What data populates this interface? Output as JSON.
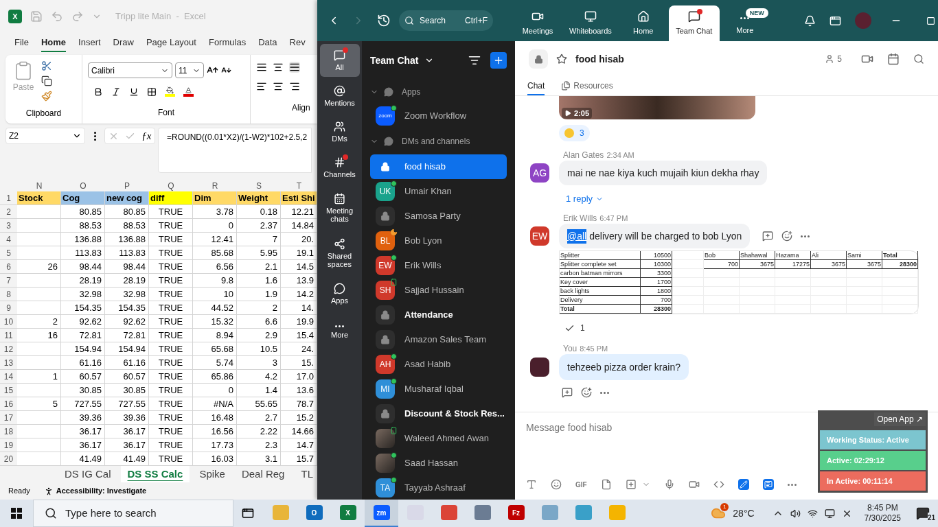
{
  "excel": {
    "logo": "X",
    "title": "Tripp lite Main  -  Excel",
    "menu_tabs": [
      {
        "label": "File",
        "selected": false
      },
      {
        "label": "Home",
        "selected": true
      },
      {
        "label": "Insert",
        "selected": false
      },
      {
        "label": "Draw",
        "selected": false
      },
      {
        "label": "Page Layout",
        "selected": false
      },
      {
        "label": "Formulas",
        "selected": false
      },
      {
        "label": "Data",
        "selected": false
      },
      {
        "label": "Rev",
        "selected": false
      }
    ],
    "ribbon": {
      "paste": "Paste",
      "font_name": "Calibri",
      "font_size": "11",
      "groups": [
        "Clipboard",
        "Font",
        "Align"
      ]
    },
    "name_box": "Z2",
    "function_label": "ƒx",
    "formula": "=ROUND((0.01*X2)/(1-W2)*102+2.5,2",
    "header_row_number": "1",
    "columns": [
      {
        "letter": "N",
        "header": "Stock",
        "color": "#ffd966"
      },
      {
        "letter": "O",
        "header": "Cog",
        "color": "#9bc2e6"
      },
      {
        "letter": "P",
        "header": "new cog",
        "color": "#9bc2e6"
      },
      {
        "letter": "Q",
        "header": "diff",
        "color": "#ffff00"
      },
      {
        "letter": "R",
        "header": "Dim",
        "color": "#ffd966"
      },
      {
        "letter": "S",
        "header": "Weight",
        "color": "#ffd966"
      },
      {
        "letter": "T",
        "header": "Esti Shi",
        "color": "#ffd966"
      }
    ],
    "rows": [
      {
        "number": "2",
        "cells": [
          "",
          "80.85",
          "80.85",
          "TRUE",
          "3.78",
          "0.18",
          "12.21"
        ]
      },
      {
        "number": "3",
        "cells": [
          "",
          "88.53",
          "88.53",
          "TRUE",
          "0",
          "2.37",
          "14.84"
        ]
      },
      {
        "number": "4",
        "cells": [
          "",
          "136.88",
          "136.88",
          "TRUE",
          "12.41",
          "7",
          "20."
        ]
      },
      {
        "number": "5",
        "cells": [
          "",
          "113.83",
          "113.83",
          "TRUE",
          "85.68",
          "5.95",
          "19.1"
        ]
      },
      {
        "number": "6",
        "cells": [
          "26",
          "98.44",
          "98.44",
          "TRUE",
          "6.56",
          "2.1",
          "14.5"
        ]
      },
      {
        "number": "7",
        "cells": [
          "",
          "28.19",
          "28.19",
          "TRUE",
          "9.8",
          "1.6",
          "13.9"
        ]
      },
      {
        "number": "8",
        "cells": [
          "",
          "32.98",
          "32.98",
          "TRUE",
          "10",
          "1.9",
          "14.2"
        ]
      },
      {
        "number": "9",
        "cells": [
          "",
          "154.35",
          "154.35",
          "TRUE",
          "44.52",
          "2",
          "14."
        ]
      },
      {
        "number": "10",
        "cells": [
          "2",
          "92.62",
          "92.62",
          "TRUE",
          "15.32",
          "6.6",
          "19.9"
        ]
      },
      {
        "number": "11",
        "cells": [
          "16",
          "72.81",
          "72.81",
          "TRUE",
          "8.94",
          "2.9",
          "15.4"
        ]
      },
      {
        "number": "12",
        "cells": [
          "",
          "154.94",
          "154.94",
          "TRUE",
          "65.68",
          "10.5",
          "24."
        ]
      },
      {
        "number": "13",
        "cells": [
          "",
          "61.16",
          "61.16",
          "TRUE",
          "5.74",
          "3",
          "15."
        ]
      },
      {
        "number": "14",
        "cells": [
          "1",
          "60.57",
          "60.57",
          "TRUE",
          "65.86",
          "4.2",
          "17.0"
        ]
      },
      {
        "number": "15",
        "cells": [
          "",
          "30.85",
          "30.85",
          "TRUE",
          "0",
          "1.4",
          "13.6"
        ]
      },
      {
        "number": "16",
        "cells": [
          "5",
          "727.55",
          "727.55",
          "TRUE",
          "#N/A",
          "55.65",
          "78.7"
        ]
      },
      {
        "number": "17",
        "cells": [
          "",
          "39.36",
          "39.36",
          "TRUE",
          "16.48",
          "2.7",
          "15.2"
        ]
      },
      {
        "number": "18",
        "cells": [
          "",
          "36.17",
          "36.17",
          "TRUE",
          "16.56",
          "2.22",
          "14.66"
        ]
      },
      {
        "number": "19",
        "cells": [
          "",
          "36.17",
          "36.17",
          "TRUE",
          "17.73",
          "2.3",
          "14.7"
        ]
      },
      {
        "number": "20",
        "cells": [
          "",
          "41.49",
          "41.49",
          "TRUE",
          "16.03",
          "3.1",
          "15.7"
        ]
      }
    ],
    "sheet_tabs": [
      {
        "label": "DS IG Cal",
        "selected": false
      },
      {
        "label": "DS SS Calc",
        "selected": true
      },
      {
        "label": "Spike",
        "selected": false
      },
      {
        "label": "Deal Reg",
        "selected": false
      },
      {
        "label": "TL",
        "selected": false
      }
    ],
    "status": "Ready",
    "accessibility": "Accessibility: Investigate"
  },
  "zoom": {
    "search": {
      "placeholder": "Search",
      "shortcut": "Ctrl+F"
    },
    "nav": [
      {
        "label": "Meetings",
        "selected": false,
        "dot": false
      },
      {
        "label": "Whiteboards",
        "selected": false,
        "dot": false
      },
      {
        "label": "Home",
        "selected": false,
        "dot": false
      },
      {
        "label": "Team Chat",
        "selected": true,
        "dot": true
      },
      {
        "label": "More",
        "selected": false,
        "dot": false,
        "badge": "NEW"
      }
    ],
    "rail": [
      {
        "label": "All",
        "selected": true,
        "dot": true
      },
      {
        "label": "Mentions",
        "selected": false,
        "dot": false
      },
      {
        "label": "DMs",
        "selected": false,
        "dot": false
      },
      {
        "label": "Channels",
        "selected": false,
        "dot": true
      },
      {
        "label": "Meeting chats",
        "selected": false,
        "dot": false
      },
      {
        "label": "Shared spaces",
        "selected": false,
        "dot": false
      },
      {
        "label": "Apps",
        "selected": false,
        "dot": false
      },
      {
        "label": "More",
        "selected": false,
        "dot": false
      }
    ],
    "sidebar": {
      "title": "Team Chat",
      "sections": [
        {
          "label": "Apps",
          "expanded": true,
          "items": [
            {
              "kind": "app",
              "avatar": "zoom",
              "name": "Zoom Workflow",
              "presence": {
                "kind": "online"
              },
              "selected": false,
              "unread": false
            }
          ]
        },
        {
          "label": "DMs and channels",
          "expanded": true,
          "items": [
            {
              "kind": "channel",
              "name": "food hisab",
              "selected": true,
              "unread": false
            },
            {
              "kind": "person",
              "initials": "UK",
              "color": "#1aa38c",
              "name": "Umair Khan",
              "presence": {
                "kind": "online"
              },
              "selected": false,
              "unread": false
            },
            {
              "kind": "channel",
              "name": "Samosa Party",
              "selected": false,
              "unread": false
            },
            {
              "kind": "person",
              "initials": "BL",
              "color": "#e0610e",
              "name": "Bob Lyon",
              "presence": {
                "kind": "away"
              },
              "selected": false,
              "unread": false
            },
            {
              "kind": "person",
              "initials": "EW",
              "color": "#d0392b",
              "name": "Erik Wills",
              "presence": {
                "kind": "online"
              },
              "selected": false,
              "unread": false
            },
            {
              "kind": "person",
              "initials": "SH",
              "color": "#d0392b",
              "name": "Sajjad Hussain",
              "presence": {
                "kind": "mobile"
              },
              "selected": false,
              "unread": false
            },
            {
              "kind": "channel",
              "name": "Attendance",
              "selected": false,
              "unread": true
            },
            {
              "kind": "channel",
              "name": "Amazon Sales Team",
              "selected": false,
              "unread": false
            },
            {
              "kind": "person",
              "initials": "AH",
              "color": "#d0392b",
              "name": "Asad Habib",
              "presence": {
                "kind": "online"
              },
              "selected": false,
              "unread": false
            },
            {
              "kind": "person",
              "initials": "MI",
              "color": "#2f8fd8",
              "name": "Musharaf Iqbal",
              "presence": {
                "kind": "online"
              },
              "selected": false,
              "unread": false
            },
            {
              "kind": "channel",
              "name": "Discount & Stock Res...",
              "selected": false,
              "unread": true
            },
            {
              "kind": "photo",
              "name": "Waleed Ahmed Awan",
              "presence": {
                "kind": "mobile"
              },
              "selected": false,
              "unread": false
            },
            {
              "kind": "photo",
              "name": "Saad Hassan",
              "presence": {
                "kind": "online"
              },
              "selected": false,
              "unread": false
            },
            {
              "kind": "person",
              "initials": "TA",
              "color": "#2f8fd8",
              "name": "Tayyab Ashraaf",
              "presence": {
                "kind": "online"
              },
              "selected": false,
              "unread": false
            }
          ]
        }
      ]
    },
    "chat": {
      "title": "food hisab",
      "members": "5",
      "tabs": [
        {
          "label": "Chat",
          "selected": true
        },
        {
          "label": "Resources",
          "selected": false
        }
      ],
      "video": {
        "duration": "2:05"
      },
      "reaction": {
        "count": "3"
      },
      "messages": [
        {
          "author": "Alan Gates",
          "time": "2:34 AM",
          "initials": "AG",
          "color": "#8e44c4",
          "text": "mai ne nae kiya kuch mujaih kiun dekha rhay",
          "mine": false,
          "replies": "1 reply"
        },
        {
          "author": "Erik Wills",
          "time": "6:47 PM",
          "initials": "EW",
          "color": "#d0392b",
          "mention": "@all",
          "text": "delivery will be charged to bob Lyon",
          "mine": false,
          "attachment": {
            "items": [
              {
                "label": "Splitter",
                "value": "10500",
                "bold": false
              },
              {
                "label": "Splitter complete set",
                "value": "10300",
                "bold": false
              },
              {
                "label": "carbon batman mirrors",
                "value": "3300",
                "bold": false
              },
              {
                "label": "Key cover",
                "value": "1700",
                "bold": false
              },
              {
                "label": "back lights",
                "value": "1800",
                "bold": false
              },
              {
                "label": "Delivery",
                "value": "700",
                "bold": false
              },
              {
                "label": "Total",
                "value": "28300",
                "bold": true
              }
            ],
            "shares": [
              {
                "name": "Bob",
                "value": "700",
                "bold": false
              },
              {
                "name": "Shahawal",
                "value": "3675",
                "bold": false
              },
              {
                "name": "Hazama",
                "value": "17275",
                "bold": false
              },
              {
                "name": "Ali",
                "value": "3675",
                "bold": false
              },
              {
                "name": "Sami",
                "value": "3675",
                "bold": false
              },
              {
                "name": "Total",
                "value": "28300",
                "bold": true
              }
            ]
          },
          "receipt": "1"
        },
        {
          "author": "You",
          "time": "8:45 PM",
          "color": "#4a1f2c",
          "text": "tehzeeb pizza order krain?",
          "mine": true
        }
      ],
      "composer": {
        "placeholder": "Message food hisab",
        "gif": "GIF"
      }
    },
    "widget": {
      "open_label": "Open App ↗",
      "rows": [
        {
          "text": "Working Status: Active",
          "color": "#7cc5cf"
        },
        {
          "text": "Active: 02:29:12",
          "color": "#58cf8c"
        },
        {
          "text": "In Active: 00:11:14",
          "color": "#ec6c5e"
        }
      ]
    }
  },
  "taskbar": {
    "search_placeholder": "Type here to search",
    "apps": [
      {
        "color": "#e8b53a",
        "selected": false
      },
      {
        "color": "#0f6cbd",
        "label": "O",
        "selected": false
      },
      {
        "color": "#107c41",
        "label": "X",
        "selected": false
      },
      {
        "color": "#0b5cff",
        "label": "zm",
        "selected": true
      },
      {
        "color": "#d9d9e8",
        "selected": false
      },
      {
        "color": "#db4437",
        "selected": false
      },
      {
        "color": "#6b7c93",
        "selected": false
      },
      {
        "color": "#bf0000",
        "label": "Fz",
        "selected": false
      },
      {
        "color": "#7aa7c7",
        "selected": false
      },
      {
        "color": "#3aa0c8",
        "selected": false
      },
      {
        "color": "#f4b400",
        "selected": false
      }
    ],
    "weather_badge": "1",
    "weather": "28°C",
    "time": "8:45 PM",
    "date": "7/30/2025",
    "notifications": "21"
  }
}
